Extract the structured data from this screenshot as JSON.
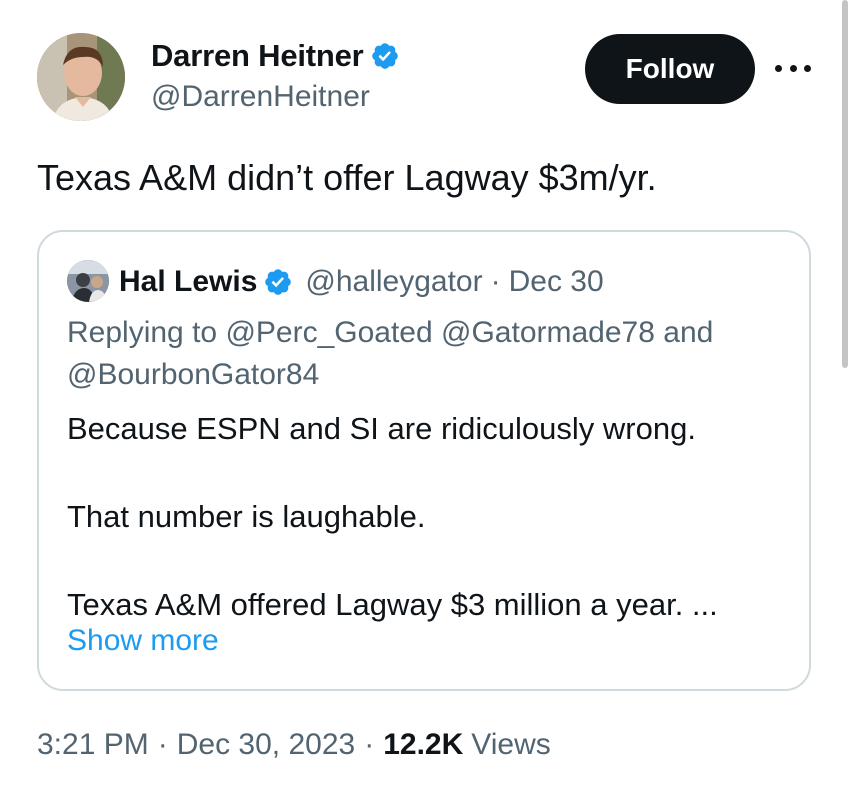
{
  "tweet": {
    "author": {
      "name": "Darren Heitner",
      "handle": "@DarrenHeitner",
      "verified": true
    },
    "follow_label": "Follow",
    "more_icon": "more-horizontal-icon",
    "text": "Texas A&M didn’t offer Lagway $3m/yr.",
    "time": "3:21 PM",
    "date": "Dec 30, 2023",
    "separator": "·",
    "views_count": "12.2K",
    "views_label": "Views"
  },
  "quote": {
    "author": {
      "name": "Hal Lewis",
      "handle": "@halleygator",
      "verified": true
    },
    "separator": "·",
    "date": "Dec 30",
    "reply_prefix": "Replying to",
    "reply_mentions": [
      "@Perc_Goated",
      "@Gatormade78"
    ],
    "reply_and": "and",
    "reply_last_mention": "@BourbonGator84",
    "body": [
      "Because ESPN and SI are ridiculously wrong.",
      "That number is laughable.",
      "Texas A&M offered Lagway $3 million a year.  ..."
    ],
    "show_more_label": "Show more"
  },
  "colors": {
    "text_primary": "#0f1419",
    "text_secondary": "#536471",
    "accent_blue": "#1d9bf0",
    "border": "#cfd9de",
    "follow_bg": "#0f1419"
  }
}
